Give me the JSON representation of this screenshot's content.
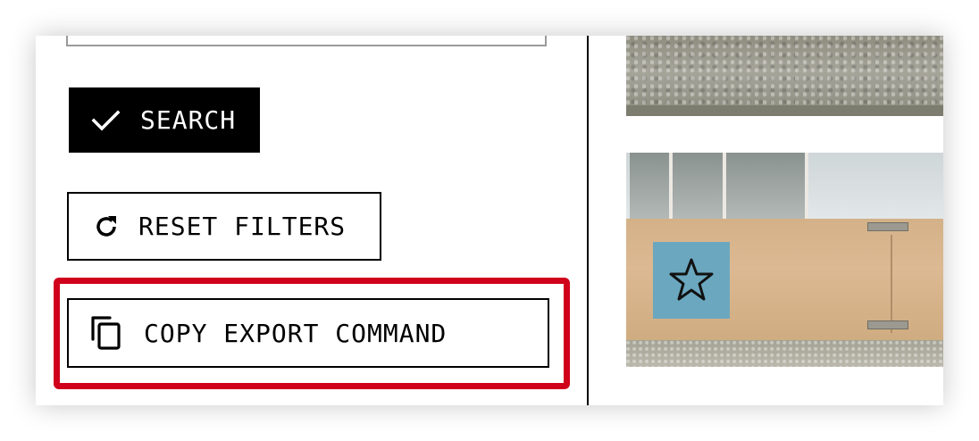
{
  "filters": {
    "search_input_value": "",
    "search_button_label": "SEARCH",
    "reset_button_label": "RESET FILTERS",
    "copy_export_button_label": "COPY EXPORT COMMAND"
  },
  "icons": {
    "search_button": "check-icon",
    "reset_button": "refresh-icon",
    "copy_export_button": "copy-icon"
  },
  "colors": {
    "primary_button_bg": "#000000",
    "primary_button_text": "#ffffff",
    "highlight": "#d0021b",
    "card": "#6ba7bf"
  },
  "results": {
    "thumbnails": [
      {
        "content": "gravel-floor"
      },
      {
        "content": "wooden-board-star-card"
      }
    ]
  }
}
